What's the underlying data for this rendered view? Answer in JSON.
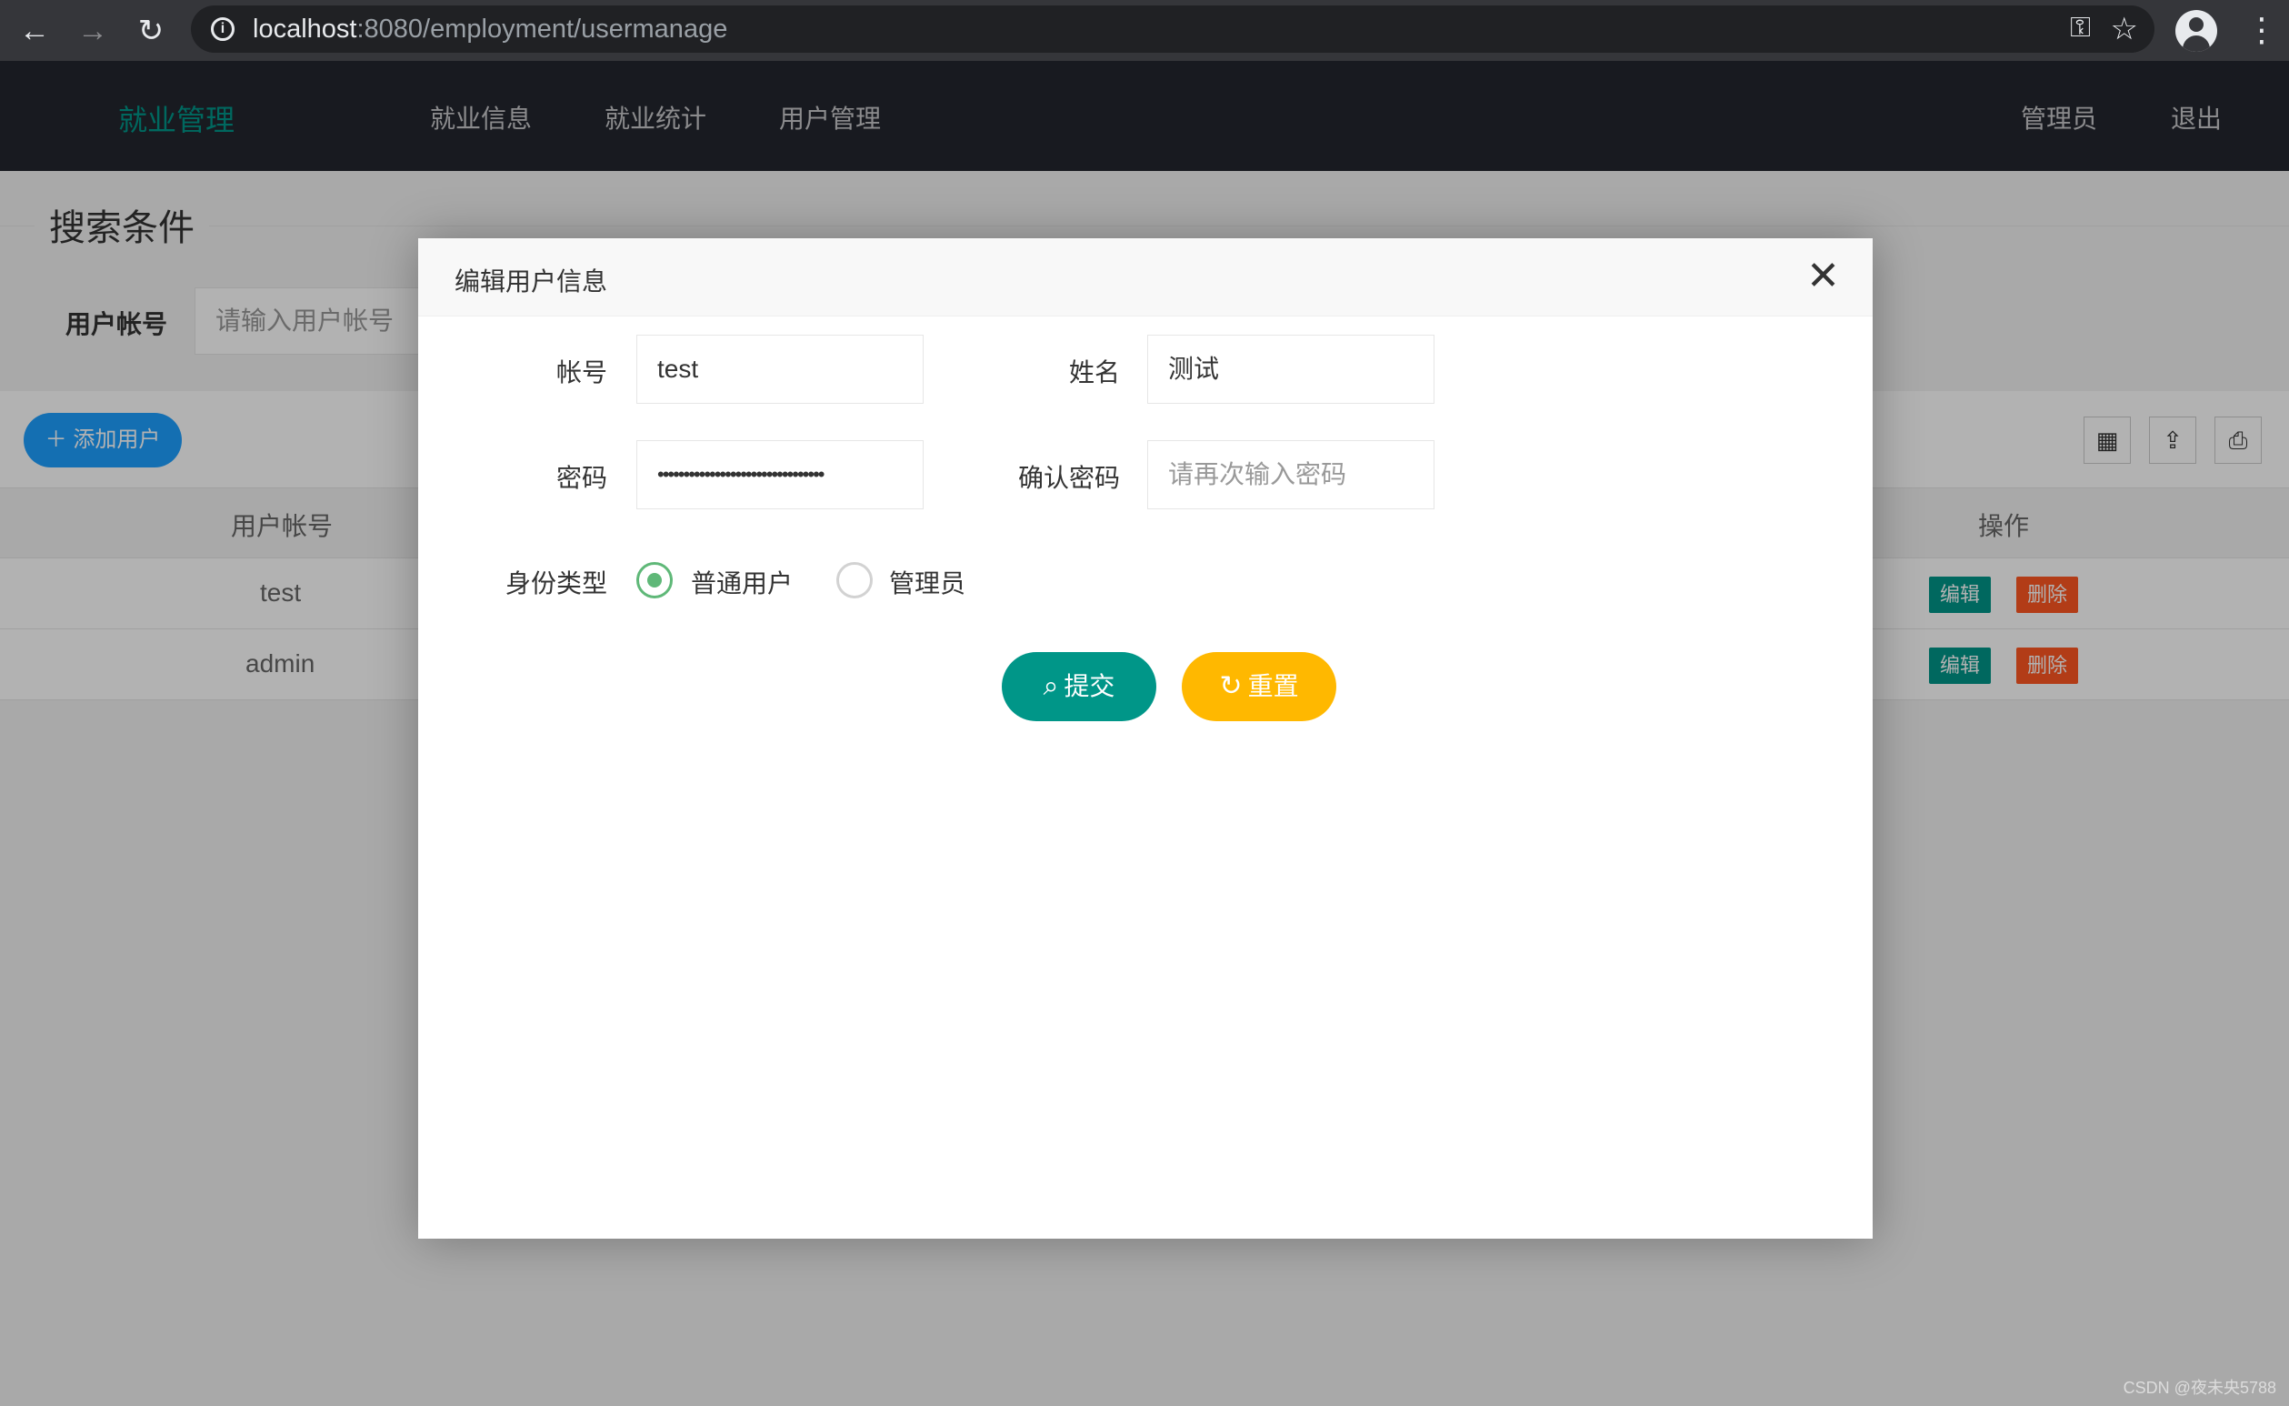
{
  "browser": {
    "url_host": "localhost",
    "url_path": ":8080/employment/usermanage"
  },
  "header": {
    "logo": "就业管理",
    "nav": [
      "就业信息",
      "就业统计",
      "用户管理"
    ],
    "user": "管理员",
    "logout": "退出"
  },
  "search": {
    "legend": "搜索条件",
    "label": "用户帐号",
    "placeholder": "请输入用户帐号"
  },
  "toolbar": {
    "add_label": "添加用户"
  },
  "table": {
    "col_account": "用户帐号",
    "col_action": "操作",
    "rows": [
      {
        "account": "test",
        "edit": "编辑",
        "delete": "删除"
      },
      {
        "account": "admin",
        "edit": "编辑",
        "delete": "删除"
      }
    ]
  },
  "modal": {
    "title": "编辑用户信息",
    "account_label": "帐号",
    "account_value": "test",
    "name_label": "姓名",
    "name_value": "测试",
    "password_label": "密码",
    "password_value": "••••••••••••••••••••••••••••••••",
    "confirm_label": "确认密码",
    "confirm_placeholder": "请再次输入密码",
    "role_label": "身份类型",
    "role_options": [
      "普通用户",
      "管理员"
    ],
    "role_selected": "普通用户",
    "submit_label": "提交",
    "reset_label": "重置"
  },
  "watermark": "CSDN @夜未央5788",
  "colors": {
    "primary": "#009688",
    "warm": "#ffb800",
    "danger": "#ff5722",
    "blue": "#1e9fff",
    "header_bg": "#23262e"
  }
}
